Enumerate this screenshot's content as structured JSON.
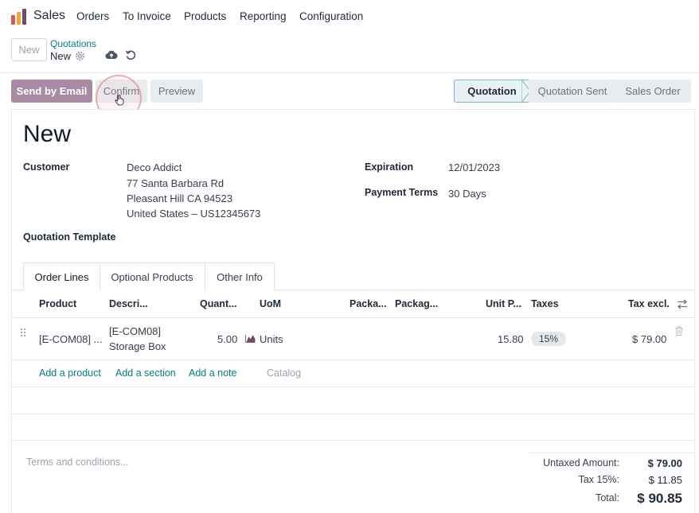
{
  "app": {
    "name": "Sales",
    "menu": [
      "Orders",
      "To Invoice",
      "Products",
      "Reporting",
      "Configuration"
    ]
  },
  "breadcrumb": {
    "new_button": "New",
    "parent": "Quotations",
    "current": "New"
  },
  "actions": {
    "send_email": "Send by Email",
    "confirm": "Confirm",
    "preview": "Preview"
  },
  "status": {
    "steps": [
      "Quotation",
      "Quotation Sent",
      "Sales Order"
    ],
    "active": "Quotation"
  },
  "form": {
    "title": "New",
    "customer_label": "Customer",
    "customer_name": "Deco Addict",
    "customer_address": [
      "77 Santa Barbara Rd",
      "Pleasant Hill CA 94523",
      "United States – US12345673"
    ],
    "expiration_label": "Expiration",
    "expiration_value": "12/01/2023",
    "payment_terms_label": "Payment Terms",
    "payment_terms_value": "30 Days",
    "template_label": "Quotation Template"
  },
  "tabs": [
    "Order Lines",
    "Optional Products",
    "Other Info"
  ],
  "table": {
    "headers": [
      "Product",
      "Descri...",
      "Quant...",
      "UoM",
      "Packa...",
      "Packag...",
      "Unit P...",
      "Taxes",
      "Tax excl."
    ],
    "rows": [
      {
        "product": "[E-COM08] ...",
        "description_line1": "[E-COM08]",
        "description_line2": "Storage Box",
        "quantity": "5.00",
        "uom": "Units",
        "unit_price": "15.80",
        "taxes": "15%",
        "subtotal": "$ 79.00"
      }
    ],
    "add_product": "Add a product",
    "add_section": "Add a section",
    "add_note": "Add a note",
    "catalog": "Catalog"
  },
  "footer": {
    "terms_placeholder": "Terms and conditions...",
    "untaxed_label": "Untaxed Amount:",
    "untaxed_value": "$ 79.00",
    "tax_label": "Tax 15%:",
    "tax_value": "$ 11.85",
    "total_label": "Total:",
    "total_value": "$ 90.85"
  },
  "colors": {
    "accent": "#017e84",
    "primary_button": "#a88ba3"
  }
}
